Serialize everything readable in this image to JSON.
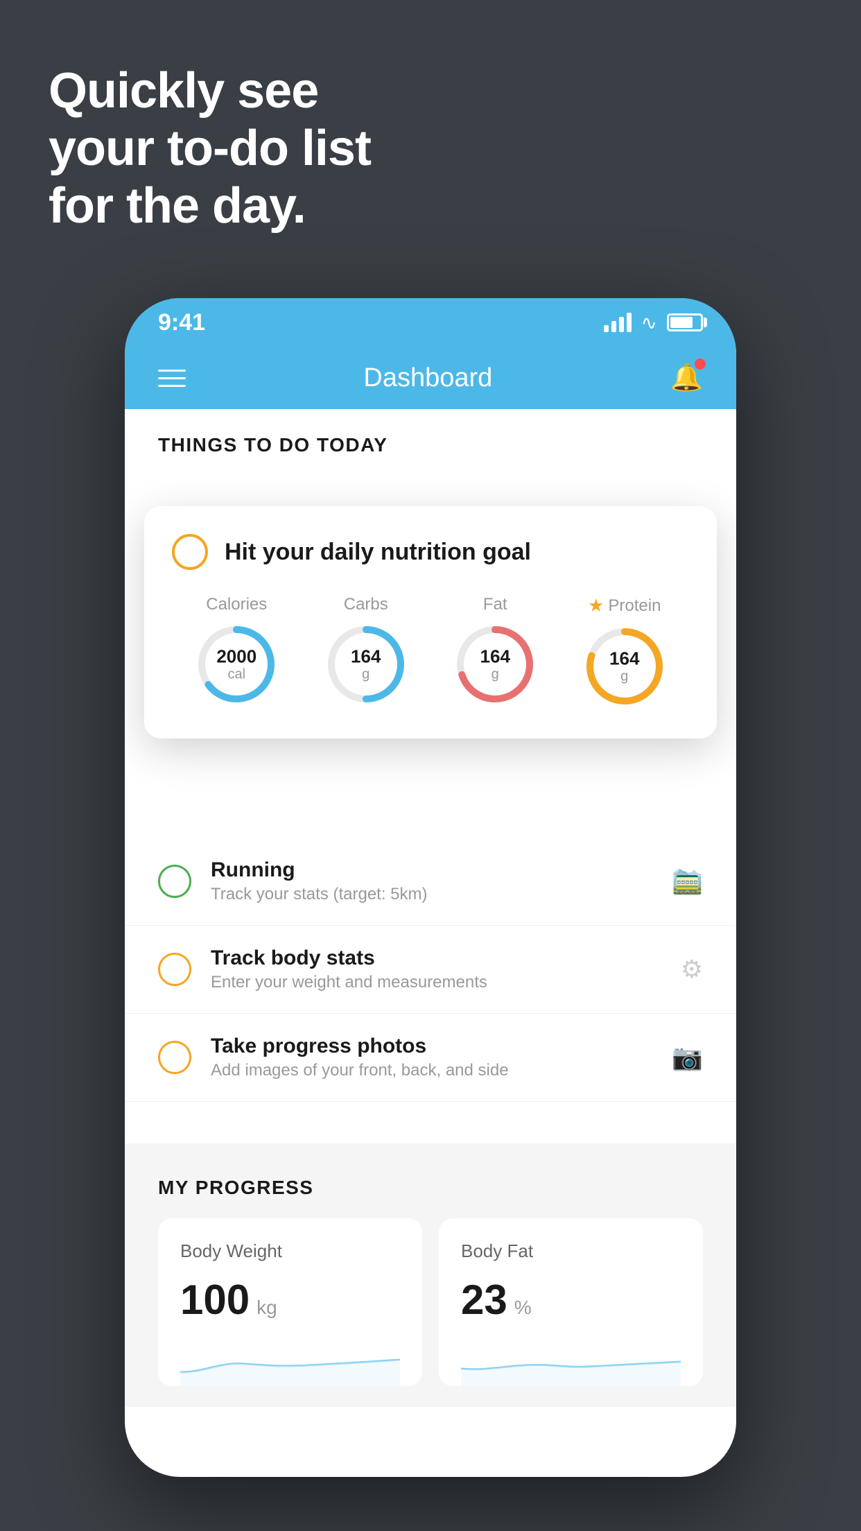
{
  "hero": {
    "line1": "Quickly see",
    "line2": "your to-do list",
    "line3": "for the day."
  },
  "statusBar": {
    "time": "9:41"
  },
  "appHeader": {
    "title": "Dashboard"
  },
  "thingsToDo": {
    "sectionTitle": "THINGS TO DO TODAY"
  },
  "nutritionCard": {
    "title": "Hit your daily nutrition goal",
    "nutrients": [
      {
        "label": "Calories",
        "value": "2000",
        "unit": "cal",
        "color": "#4cb8e8",
        "percent": 65,
        "starred": false
      },
      {
        "label": "Carbs",
        "value": "164",
        "unit": "g",
        "color": "#4cb8e8",
        "percent": 50,
        "starred": false
      },
      {
        "label": "Fat",
        "value": "164",
        "unit": "g",
        "color": "#e87070",
        "percent": 70,
        "starred": false
      },
      {
        "label": "Protein",
        "value": "164",
        "unit": "g",
        "color": "#f5a623",
        "percent": 80,
        "starred": true
      }
    ]
  },
  "todoItems": [
    {
      "name": "Running",
      "sub": "Track your stats (target: 5km)",
      "circleColor": "green",
      "icon": "👟"
    },
    {
      "name": "Track body stats",
      "sub": "Enter your weight and measurements",
      "circleColor": "yellow",
      "icon": "⚖"
    },
    {
      "name": "Take progress photos",
      "sub": "Add images of your front, back, and side",
      "circleColor": "yellow",
      "icon": "🪪"
    }
  ],
  "progress": {
    "sectionTitle": "MY PROGRESS",
    "cards": [
      {
        "title": "Body Weight",
        "value": "100",
        "unit": "kg"
      },
      {
        "title": "Body Fat",
        "value": "23",
        "unit": "%"
      }
    ]
  }
}
